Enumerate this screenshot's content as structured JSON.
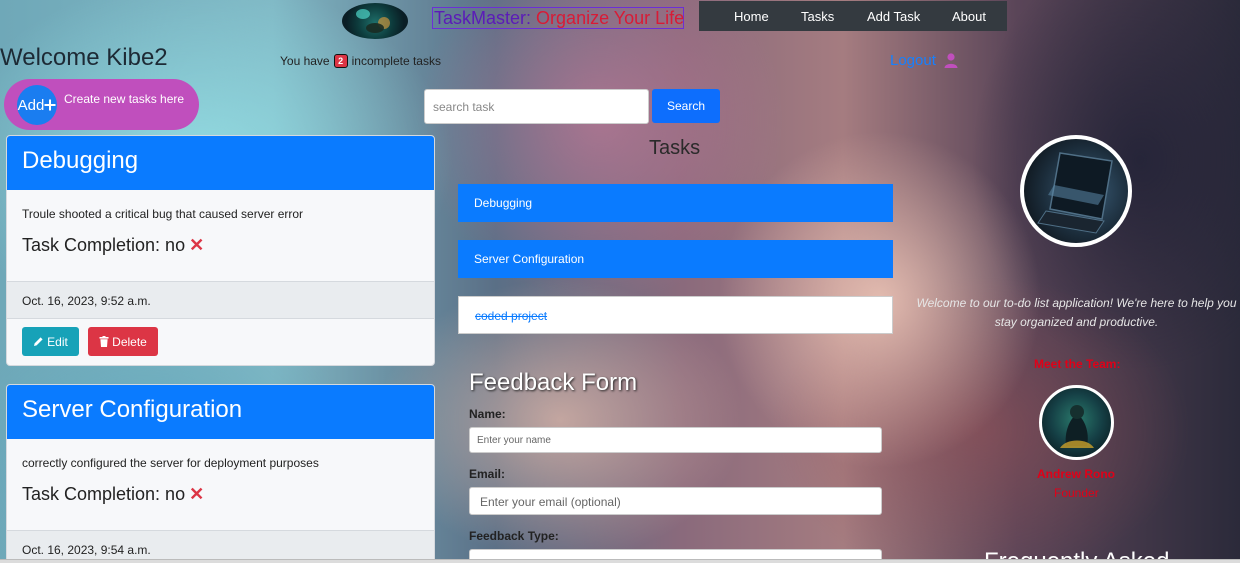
{
  "header": {
    "brand_part1": "TaskMaster:",
    "brand_part2": "Organize Your Life",
    "nav": [
      "Home",
      "Tasks",
      "Add Task",
      "About"
    ]
  },
  "welcome": "Welcome Kibe2",
  "pending": {
    "prefix": "You have",
    "count": "2",
    "suffix": "incomplete tasks"
  },
  "logout_label": "Logout",
  "add": {
    "label": "Add",
    "text": "Create new tasks here"
  },
  "search": {
    "placeholder": "search task",
    "button": "Search"
  },
  "task_cards": [
    {
      "title": "Debugging",
      "description": "Troule shooted a critical bug that caused server error",
      "completion": "Task Completion: no",
      "date": "Oct. 16, 2023, 9:52 a.m.",
      "edit": "Edit",
      "delete": "Delete"
    },
    {
      "title": "Server Configuration",
      "description": "correctly configured the server for deployment purposes",
      "completion": "Task Completion: no",
      "date": "Oct. 16, 2023, 9:54 a.m."
    }
  ],
  "task_list": {
    "heading": "Tasks",
    "items": [
      {
        "label": "Debugging",
        "done": false
      },
      {
        "label": "Server Configuration",
        "done": false
      },
      {
        "label": "coded project",
        "done": true
      }
    ]
  },
  "feedback": {
    "title": "Feedback Form",
    "name_label": "Name:",
    "name_placeholder": "Enter your name",
    "email_label": "Email:",
    "email_placeholder": "Enter your email (optional)",
    "type_label": "Feedback Type:"
  },
  "about": {
    "text": "Welcome to our to-do list application! We're here to help you stay organized and productive.",
    "team_title": "Meet the Team:",
    "member_name": "Andrew Rono",
    "member_role": "Founder",
    "footer_title": "Frequently Asked"
  },
  "colors": {
    "primary": "#0a7bff",
    "danger": "#dc3545",
    "info": "#17a2b8",
    "add_pill": "#c04fbd",
    "navbar": "#343a40",
    "team_red": "#e00018"
  },
  "icons": [
    "user-icon",
    "plus-icon",
    "cross-icon",
    "pencil-icon",
    "trash-icon"
  ]
}
